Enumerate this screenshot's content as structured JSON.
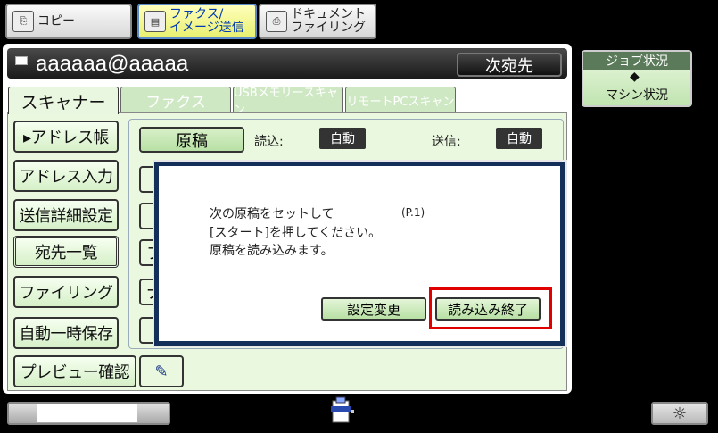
{
  "mode_tabs": [
    {
      "label": "コピー",
      "icon": "copy-icon",
      "active": false
    },
    {
      "label": "ファクス/\nイメージ送信",
      "icon": "fax-icon",
      "active": true
    },
    {
      "label": "ドキュメント\nファイリング",
      "icon": "filing-icon",
      "active": false
    }
  ],
  "header": {
    "destination": "aaaaaa@aaaaa",
    "next_button": "次宛先",
    "icon": "mail-icon"
  },
  "service_tabs": [
    "スキャナー",
    "ファクス",
    "USBメモリースキャン",
    "リモートPCスキャン"
  ],
  "sidebar": {
    "items": [
      "▸アドレス帳",
      "アドレス入力",
      "送信詳細設定",
      "宛先一覧",
      "ファイリング",
      "自動一時保存",
      "プレビュー確認"
    ]
  },
  "settings": {
    "original_button": "原稿",
    "read_label": "読込:",
    "read_value": "自動",
    "send_label": "送信:",
    "send_value": "自動",
    "partial_buttons": [
      "フ",
      "フ",
      "ナ"
    ]
  },
  "dialog": {
    "line1": "次の原稿をセットして",
    "page": "(P.1)",
    "line2": "[スタート]を押してください。",
    "line3": "原稿を読み込みます。",
    "change_button": "設定変更",
    "finish_button": "読み込み終了",
    "highlight_color": "#e00000"
  },
  "job_status": {
    "top": "ジョブ状況",
    "arrow": "◆",
    "bottom": "マシン状況"
  },
  "bottom": {
    "sun_icon": "☼"
  },
  "colors": {
    "panel": "#eaf8df",
    "dialog_border": "#14305a",
    "active_tab": "#ffffbb"
  }
}
